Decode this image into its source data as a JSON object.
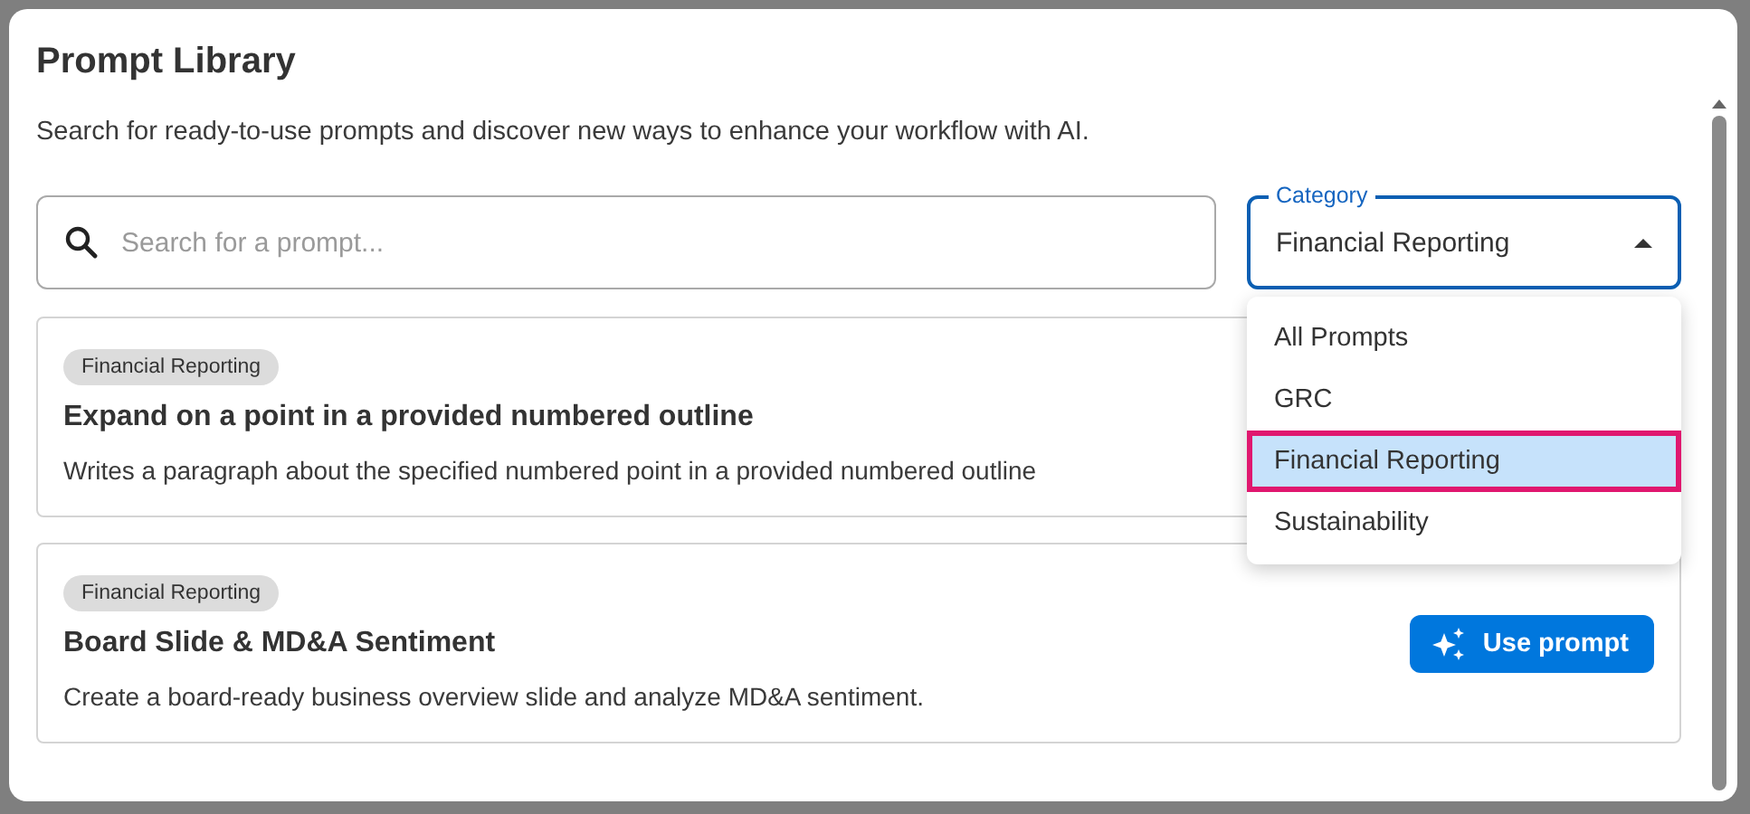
{
  "dialog": {
    "title": "Prompt Library",
    "subtitle": "Search for ready-to-use prompts and discover new ways to enhance your workflow with AI."
  },
  "search": {
    "placeholder": "Search for a prompt..."
  },
  "category": {
    "label": "Category",
    "value": "Financial Reporting",
    "expanded": true,
    "options": [
      {
        "label": "All Prompts",
        "selected": false
      },
      {
        "label": "GRC",
        "selected": false
      },
      {
        "label": "Financial Reporting",
        "selected": true
      },
      {
        "label": "Sustainability",
        "selected": false
      }
    ]
  },
  "prompts": [
    {
      "tag": "Financial Reporting",
      "title": "Expand on a point in a provided numbered outline",
      "description": "Writes a paragraph about the specified numbered point in a provided numbered outline"
    },
    {
      "tag": "Financial Reporting",
      "title": "Board Slide & MD&A Sentiment",
      "description": "Create a board-ready business overview slide and analyze MD&A sentiment.",
      "button": "Use prompt"
    }
  ]
}
